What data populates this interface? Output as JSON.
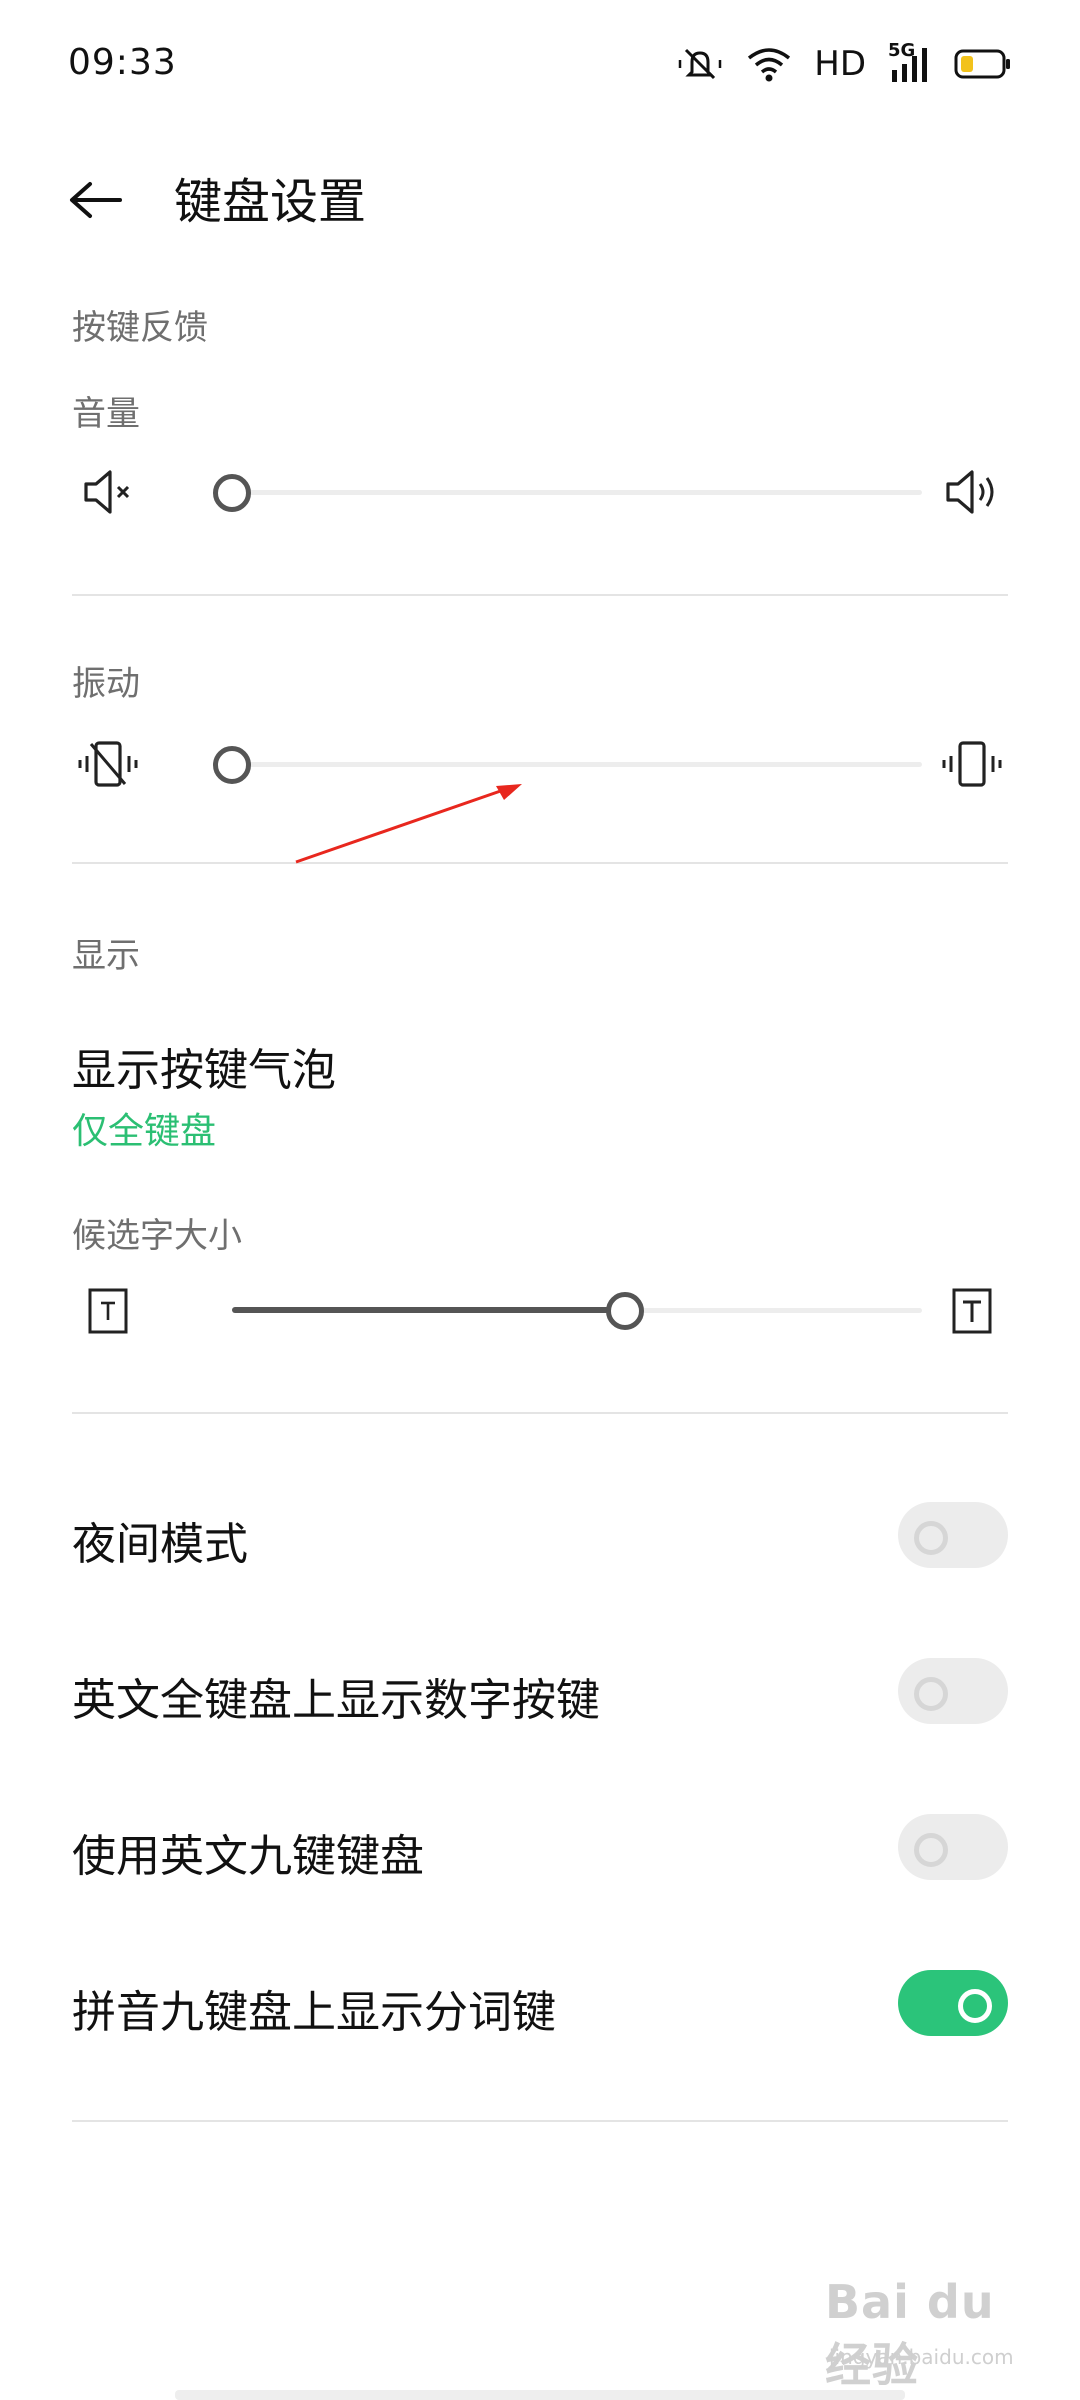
{
  "status_bar": {
    "time": "09:33",
    "hd": "HD",
    "network": "5G",
    "battery_color": "#f2c21b"
  },
  "header": {
    "title": "键盘设置"
  },
  "key_feedback": {
    "section_label": "按键反馈",
    "volume": {
      "label": "音量",
      "value": 0.0,
      "min_icon": "volume-mute-icon",
      "max_icon": "volume-up-icon"
    },
    "vibration": {
      "label": "振动",
      "value": 0.0,
      "min_icon": "vibrate-off-icon",
      "max_icon": "vibrate-icon"
    }
  },
  "display": {
    "section_label": "显示",
    "key_bubble": {
      "title": "显示按键气泡",
      "value": "仅全键盘"
    },
    "candidate_size": {
      "label": "候选字大小",
      "value": 0.57,
      "min_icon": "text-size-small-icon",
      "max_icon": "text-size-large-icon"
    }
  },
  "toggles": [
    {
      "label": "夜间模式",
      "on": false
    },
    {
      "label": "英文全键盘上显示数字按键",
      "on": false
    },
    {
      "label": "使用英文九键键盘",
      "on": false
    },
    {
      "label": "拼音九键盘上显示分词键",
      "on": true
    }
  ],
  "colors": {
    "accent": "#2bc47a",
    "annotation": "#e8271e"
  },
  "watermark": {
    "text": "Bai du 经验",
    "sub": "jingyan.baidu.com"
  }
}
